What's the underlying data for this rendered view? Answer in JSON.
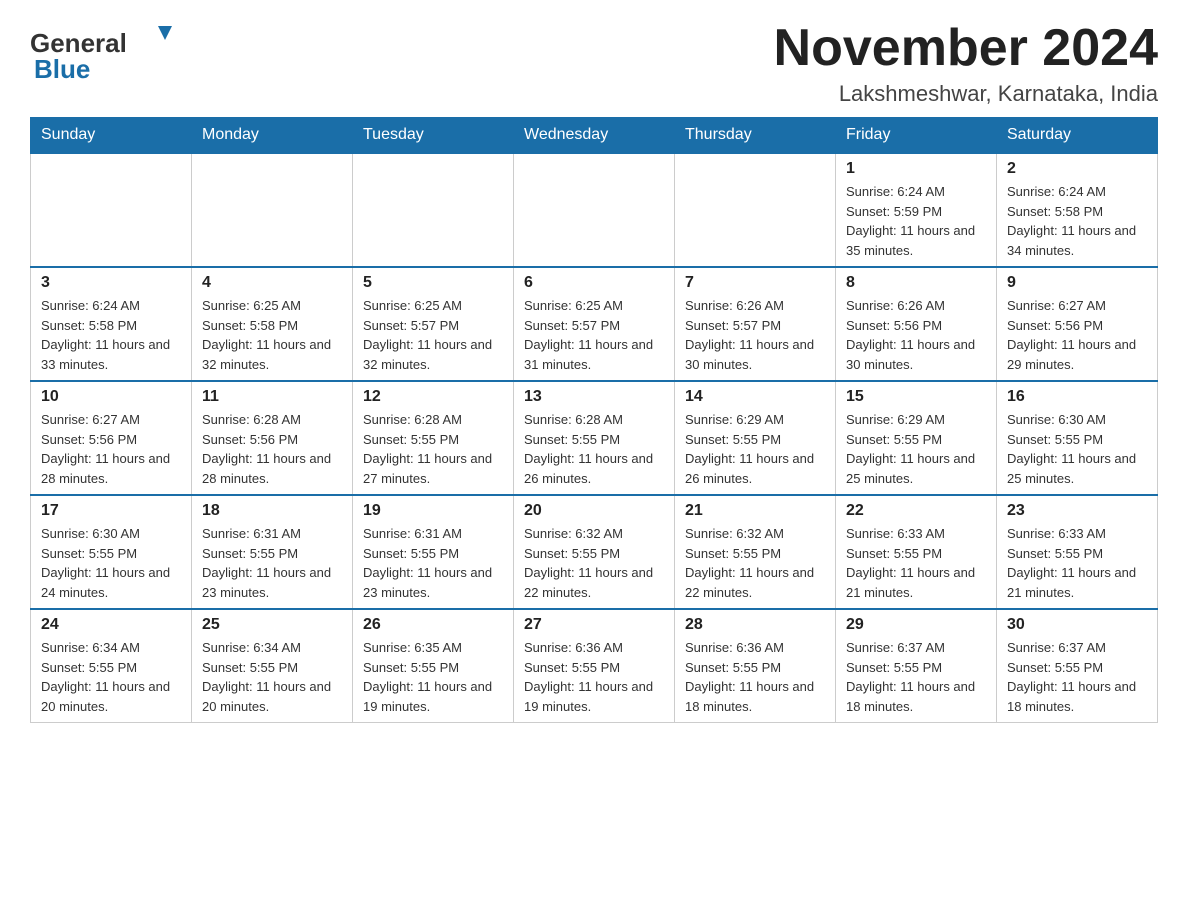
{
  "header": {
    "logo_general": "General",
    "logo_blue": "Blue",
    "month_title": "November 2024",
    "location": "Lakshmeshwar, Karnataka, India"
  },
  "weekdays": [
    "Sunday",
    "Monday",
    "Tuesday",
    "Wednesday",
    "Thursday",
    "Friday",
    "Saturday"
  ],
  "weeks": [
    [
      {
        "day": "",
        "info": ""
      },
      {
        "day": "",
        "info": ""
      },
      {
        "day": "",
        "info": ""
      },
      {
        "day": "",
        "info": ""
      },
      {
        "day": "",
        "info": ""
      },
      {
        "day": "1",
        "info": "Sunrise: 6:24 AM\nSunset: 5:59 PM\nDaylight: 11 hours and 35 minutes."
      },
      {
        "day": "2",
        "info": "Sunrise: 6:24 AM\nSunset: 5:58 PM\nDaylight: 11 hours and 34 minutes."
      }
    ],
    [
      {
        "day": "3",
        "info": "Sunrise: 6:24 AM\nSunset: 5:58 PM\nDaylight: 11 hours and 33 minutes."
      },
      {
        "day": "4",
        "info": "Sunrise: 6:25 AM\nSunset: 5:58 PM\nDaylight: 11 hours and 32 minutes."
      },
      {
        "day": "5",
        "info": "Sunrise: 6:25 AM\nSunset: 5:57 PM\nDaylight: 11 hours and 32 minutes."
      },
      {
        "day": "6",
        "info": "Sunrise: 6:25 AM\nSunset: 5:57 PM\nDaylight: 11 hours and 31 minutes."
      },
      {
        "day": "7",
        "info": "Sunrise: 6:26 AM\nSunset: 5:57 PM\nDaylight: 11 hours and 30 minutes."
      },
      {
        "day": "8",
        "info": "Sunrise: 6:26 AM\nSunset: 5:56 PM\nDaylight: 11 hours and 30 minutes."
      },
      {
        "day": "9",
        "info": "Sunrise: 6:27 AM\nSunset: 5:56 PM\nDaylight: 11 hours and 29 minutes."
      }
    ],
    [
      {
        "day": "10",
        "info": "Sunrise: 6:27 AM\nSunset: 5:56 PM\nDaylight: 11 hours and 28 minutes."
      },
      {
        "day": "11",
        "info": "Sunrise: 6:28 AM\nSunset: 5:56 PM\nDaylight: 11 hours and 28 minutes."
      },
      {
        "day": "12",
        "info": "Sunrise: 6:28 AM\nSunset: 5:55 PM\nDaylight: 11 hours and 27 minutes."
      },
      {
        "day": "13",
        "info": "Sunrise: 6:28 AM\nSunset: 5:55 PM\nDaylight: 11 hours and 26 minutes."
      },
      {
        "day": "14",
        "info": "Sunrise: 6:29 AM\nSunset: 5:55 PM\nDaylight: 11 hours and 26 minutes."
      },
      {
        "day": "15",
        "info": "Sunrise: 6:29 AM\nSunset: 5:55 PM\nDaylight: 11 hours and 25 minutes."
      },
      {
        "day": "16",
        "info": "Sunrise: 6:30 AM\nSunset: 5:55 PM\nDaylight: 11 hours and 25 minutes."
      }
    ],
    [
      {
        "day": "17",
        "info": "Sunrise: 6:30 AM\nSunset: 5:55 PM\nDaylight: 11 hours and 24 minutes."
      },
      {
        "day": "18",
        "info": "Sunrise: 6:31 AM\nSunset: 5:55 PM\nDaylight: 11 hours and 23 minutes."
      },
      {
        "day": "19",
        "info": "Sunrise: 6:31 AM\nSunset: 5:55 PM\nDaylight: 11 hours and 23 minutes."
      },
      {
        "day": "20",
        "info": "Sunrise: 6:32 AM\nSunset: 5:55 PM\nDaylight: 11 hours and 22 minutes."
      },
      {
        "day": "21",
        "info": "Sunrise: 6:32 AM\nSunset: 5:55 PM\nDaylight: 11 hours and 22 minutes."
      },
      {
        "day": "22",
        "info": "Sunrise: 6:33 AM\nSunset: 5:55 PM\nDaylight: 11 hours and 21 minutes."
      },
      {
        "day": "23",
        "info": "Sunrise: 6:33 AM\nSunset: 5:55 PM\nDaylight: 11 hours and 21 minutes."
      }
    ],
    [
      {
        "day": "24",
        "info": "Sunrise: 6:34 AM\nSunset: 5:55 PM\nDaylight: 11 hours and 20 minutes."
      },
      {
        "day": "25",
        "info": "Sunrise: 6:34 AM\nSunset: 5:55 PM\nDaylight: 11 hours and 20 minutes."
      },
      {
        "day": "26",
        "info": "Sunrise: 6:35 AM\nSunset: 5:55 PM\nDaylight: 11 hours and 19 minutes."
      },
      {
        "day": "27",
        "info": "Sunrise: 6:36 AM\nSunset: 5:55 PM\nDaylight: 11 hours and 19 minutes."
      },
      {
        "day": "28",
        "info": "Sunrise: 6:36 AM\nSunset: 5:55 PM\nDaylight: 11 hours and 18 minutes."
      },
      {
        "day": "29",
        "info": "Sunrise: 6:37 AM\nSunset: 5:55 PM\nDaylight: 11 hours and 18 minutes."
      },
      {
        "day": "30",
        "info": "Sunrise: 6:37 AM\nSunset: 5:55 PM\nDaylight: 11 hours and 18 minutes."
      }
    ]
  ]
}
